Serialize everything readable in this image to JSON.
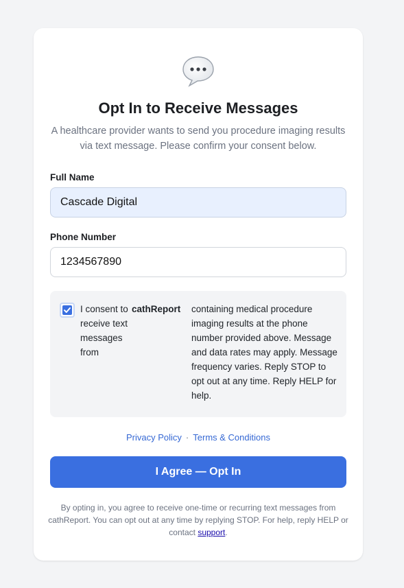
{
  "header": {
    "icon": "speech-bubble-icon",
    "title": "Opt In to Receive Messages",
    "subtitle": "A healthcare provider wants to send you procedure imaging results via text message. Please confirm your consent below."
  },
  "form": {
    "full_name_label": "Full Name",
    "full_name_value": "Cascade Digital",
    "phone_label": "Phone Number",
    "phone_value": "1234567890"
  },
  "consent": {
    "checked": true,
    "text_start": "I consent to receive text messages from",
    "brand": "cathReport",
    "text_end": "containing medical procedure imaging results at the phone number provided above. Message and data rates may apply. Message frequency varies. Reply STOP to opt out at any time. Reply HELP for help."
  },
  "links": {
    "privacy": "Privacy Policy",
    "separator": "·",
    "terms": "Terms & Conditions"
  },
  "submit_label": "I Agree — Opt In",
  "footer": {
    "text": "By opting in, you agree to receive one-time or recurring text messages from cathReport. You can opt out at any time by replying STOP. For help, reply HELP or contact",
    "support_link": "support",
    "end": "."
  },
  "colors": {
    "accent": "#3a6fe0",
    "page_bg": "#f3f4f6",
    "link": "#3568d4"
  }
}
